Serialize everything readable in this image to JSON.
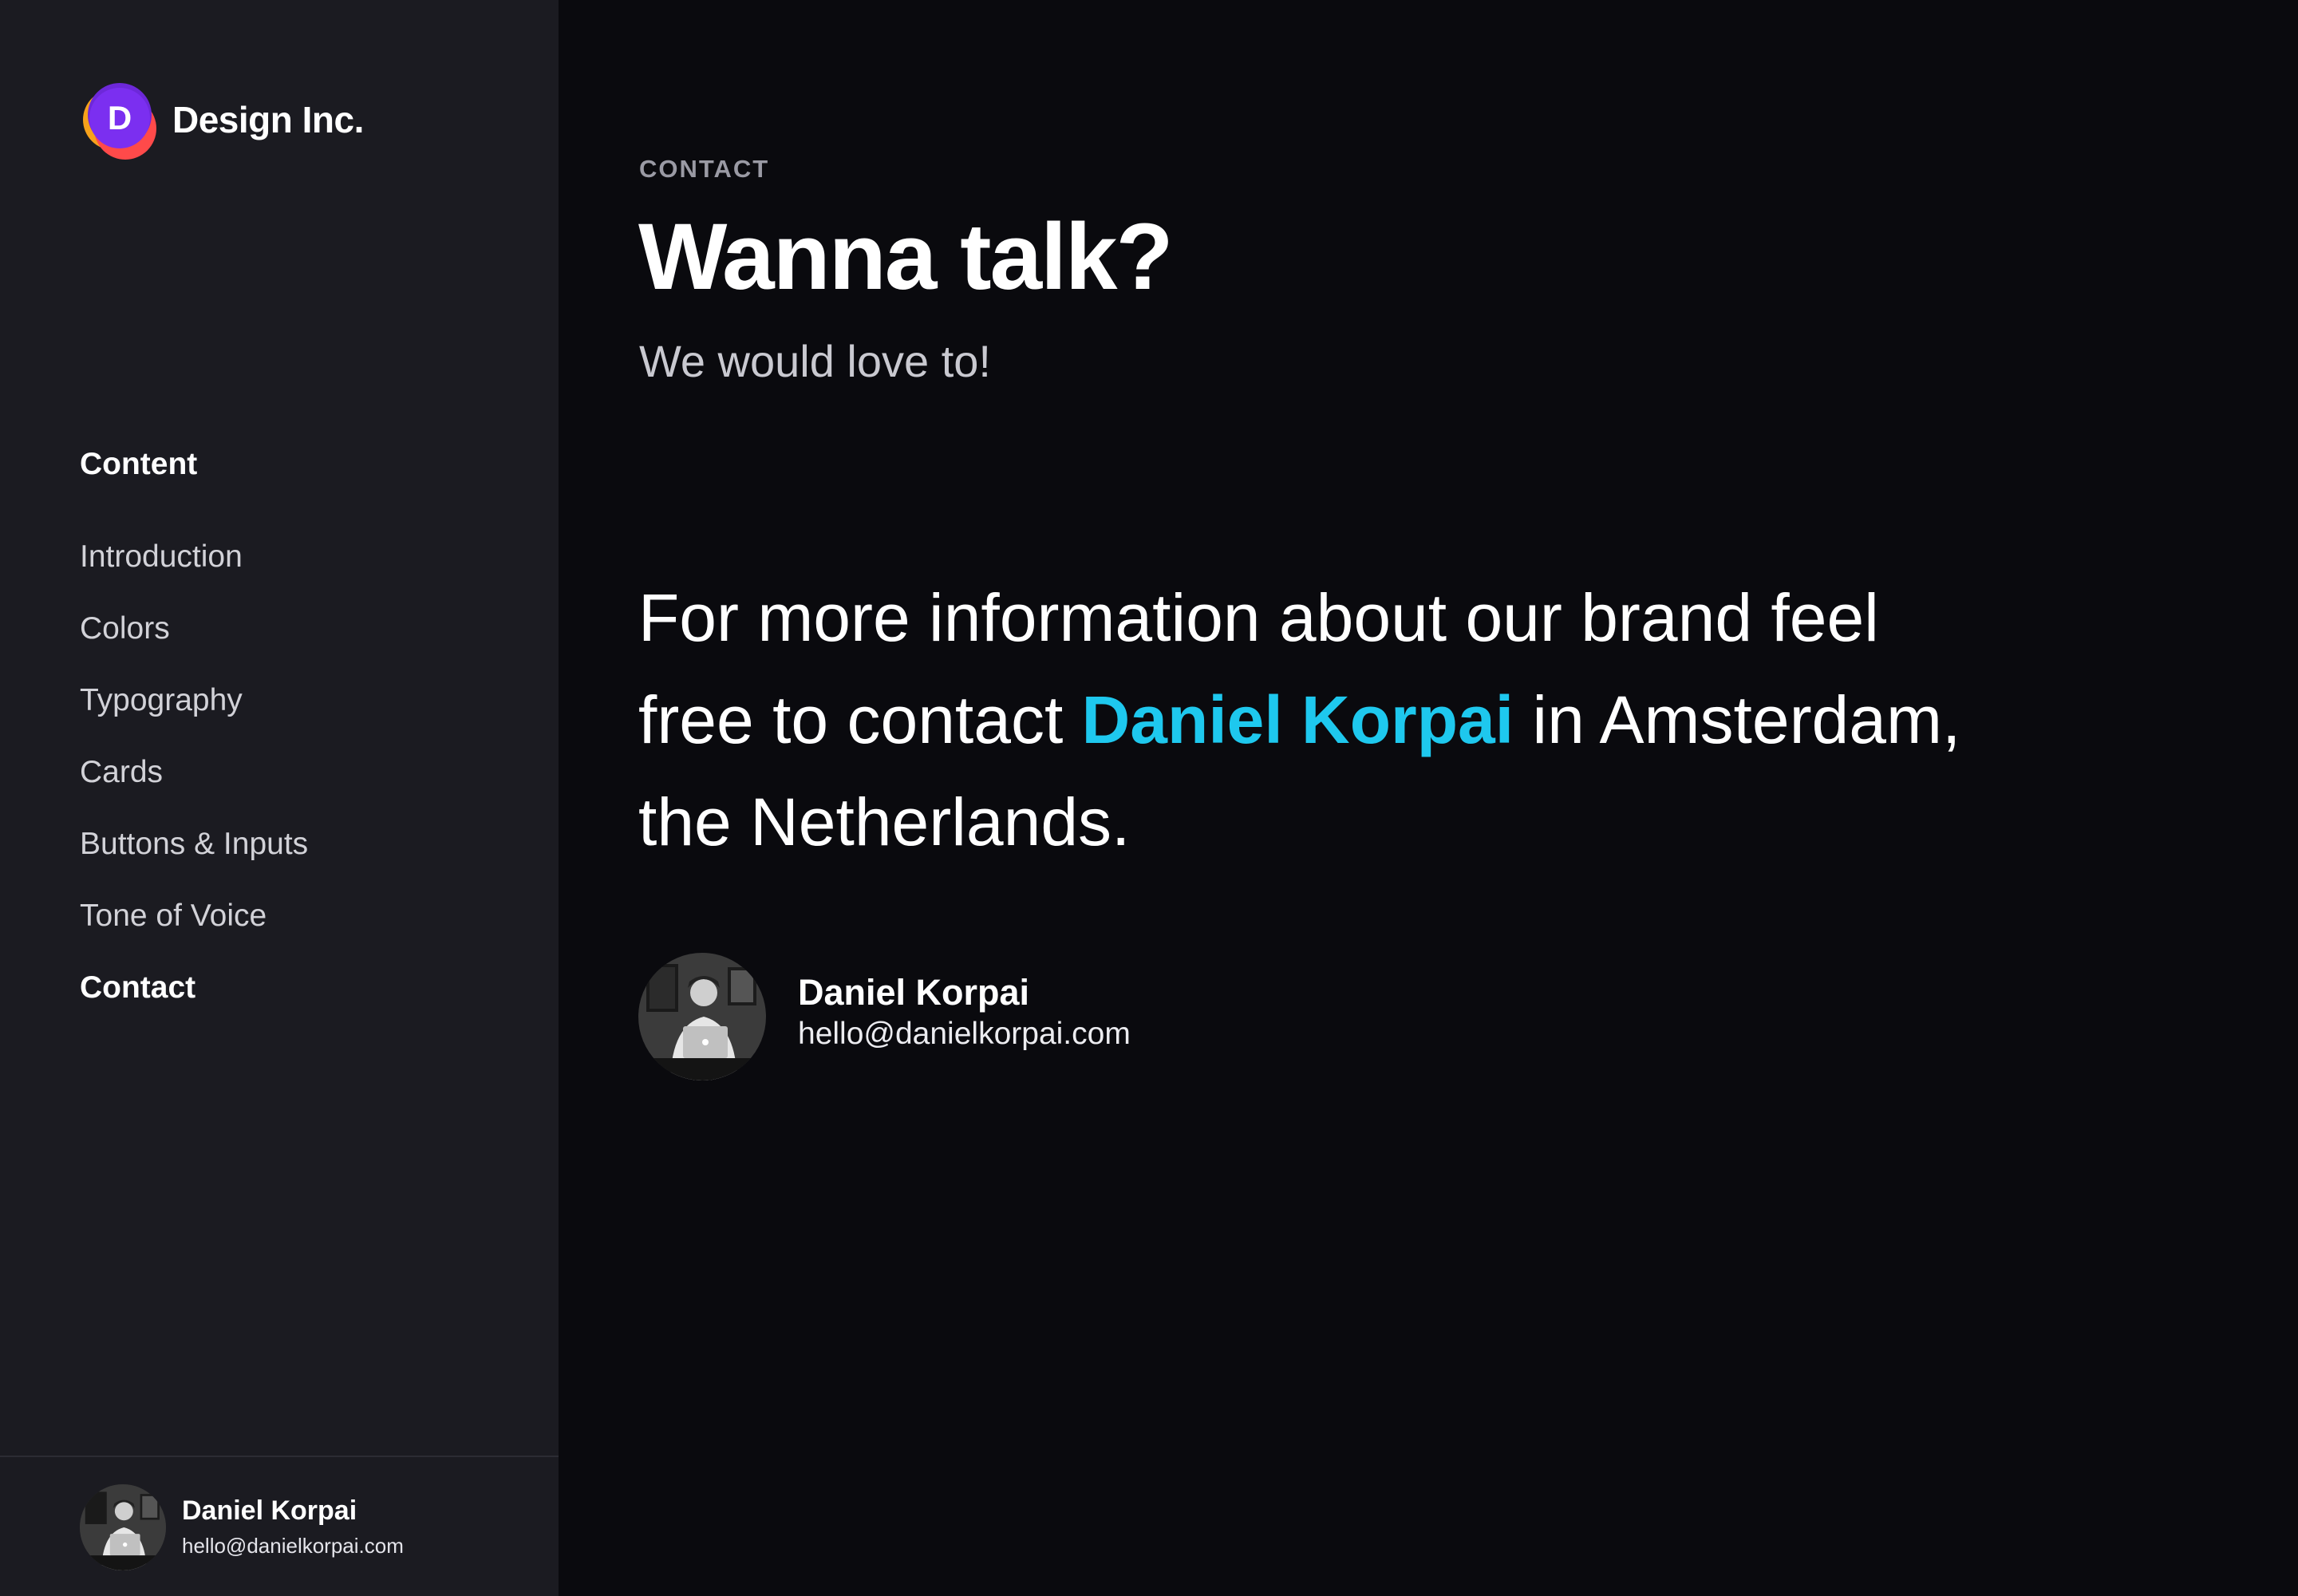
{
  "brand": {
    "logo_letter": "D",
    "name": "Design Inc.",
    "logo_colors": [
      "#f7a21b",
      "#ff4a4a",
      "#7b2ff0"
    ]
  },
  "sidebar": {
    "heading": "Content",
    "items": [
      {
        "label": "Introduction",
        "active": false
      },
      {
        "label": "Colors",
        "active": false
      },
      {
        "label": "Typography",
        "active": false
      },
      {
        "label": "Cards",
        "active": false
      },
      {
        "label": "Buttons & Inputs",
        "active": false
      },
      {
        "label": "Tone of Voice",
        "active": false
      },
      {
        "label": "Contact",
        "active": true
      }
    ],
    "footer": {
      "name": "Daniel Korpai",
      "email": "hello@danielkorpai.com"
    }
  },
  "main": {
    "eyebrow": "CONTACT",
    "title": "Wanna talk?",
    "subtitle": "We would love to!",
    "body": {
      "before": "For more information about our brand feel free to contact ",
      "highlight": "Daniel Korpai",
      "after": " in Amsterdam, the Netherlands."
    },
    "contact": {
      "name": "Daniel Korpai",
      "email": "hello@danielkorpai.com"
    }
  },
  "colors": {
    "sidebar_bg": "#1b1b21",
    "main_bg": "#0a0a0e",
    "accent": "#1ec8ee"
  }
}
